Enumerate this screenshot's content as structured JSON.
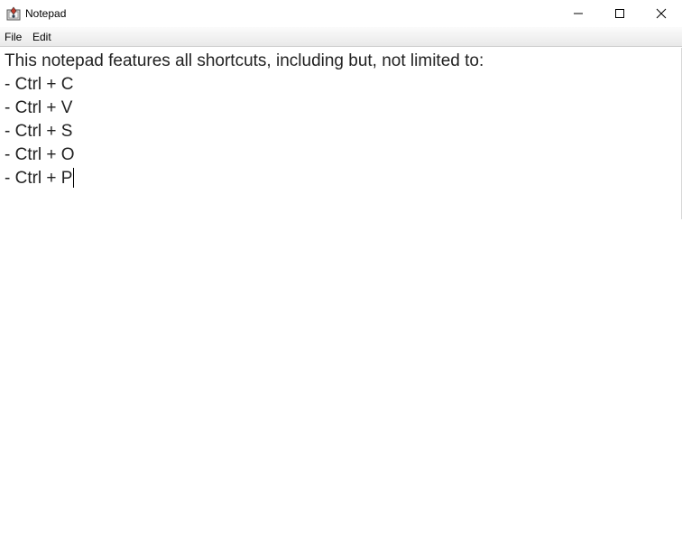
{
  "window": {
    "title": "Notepad",
    "icons": {
      "app": "notepad-app-icon",
      "minimize": "minimize-icon",
      "maximize": "maximize-icon",
      "close": "close-icon"
    }
  },
  "menubar": {
    "items": [
      {
        "label": "File"
      },
      {
        "label": "Edit"
      }
    ]
  },
  "editor": {
    "lines": [
      "This notepad features all shortcuts, including but, not limited to:",
      "- Ctrl + C",
      "- Ctrl + V",
      "- Ctrl + S",
      "- Ctrl + O",
      "- Ctrl + P"
    ],
    "text_color": "#222222"
  }
}
